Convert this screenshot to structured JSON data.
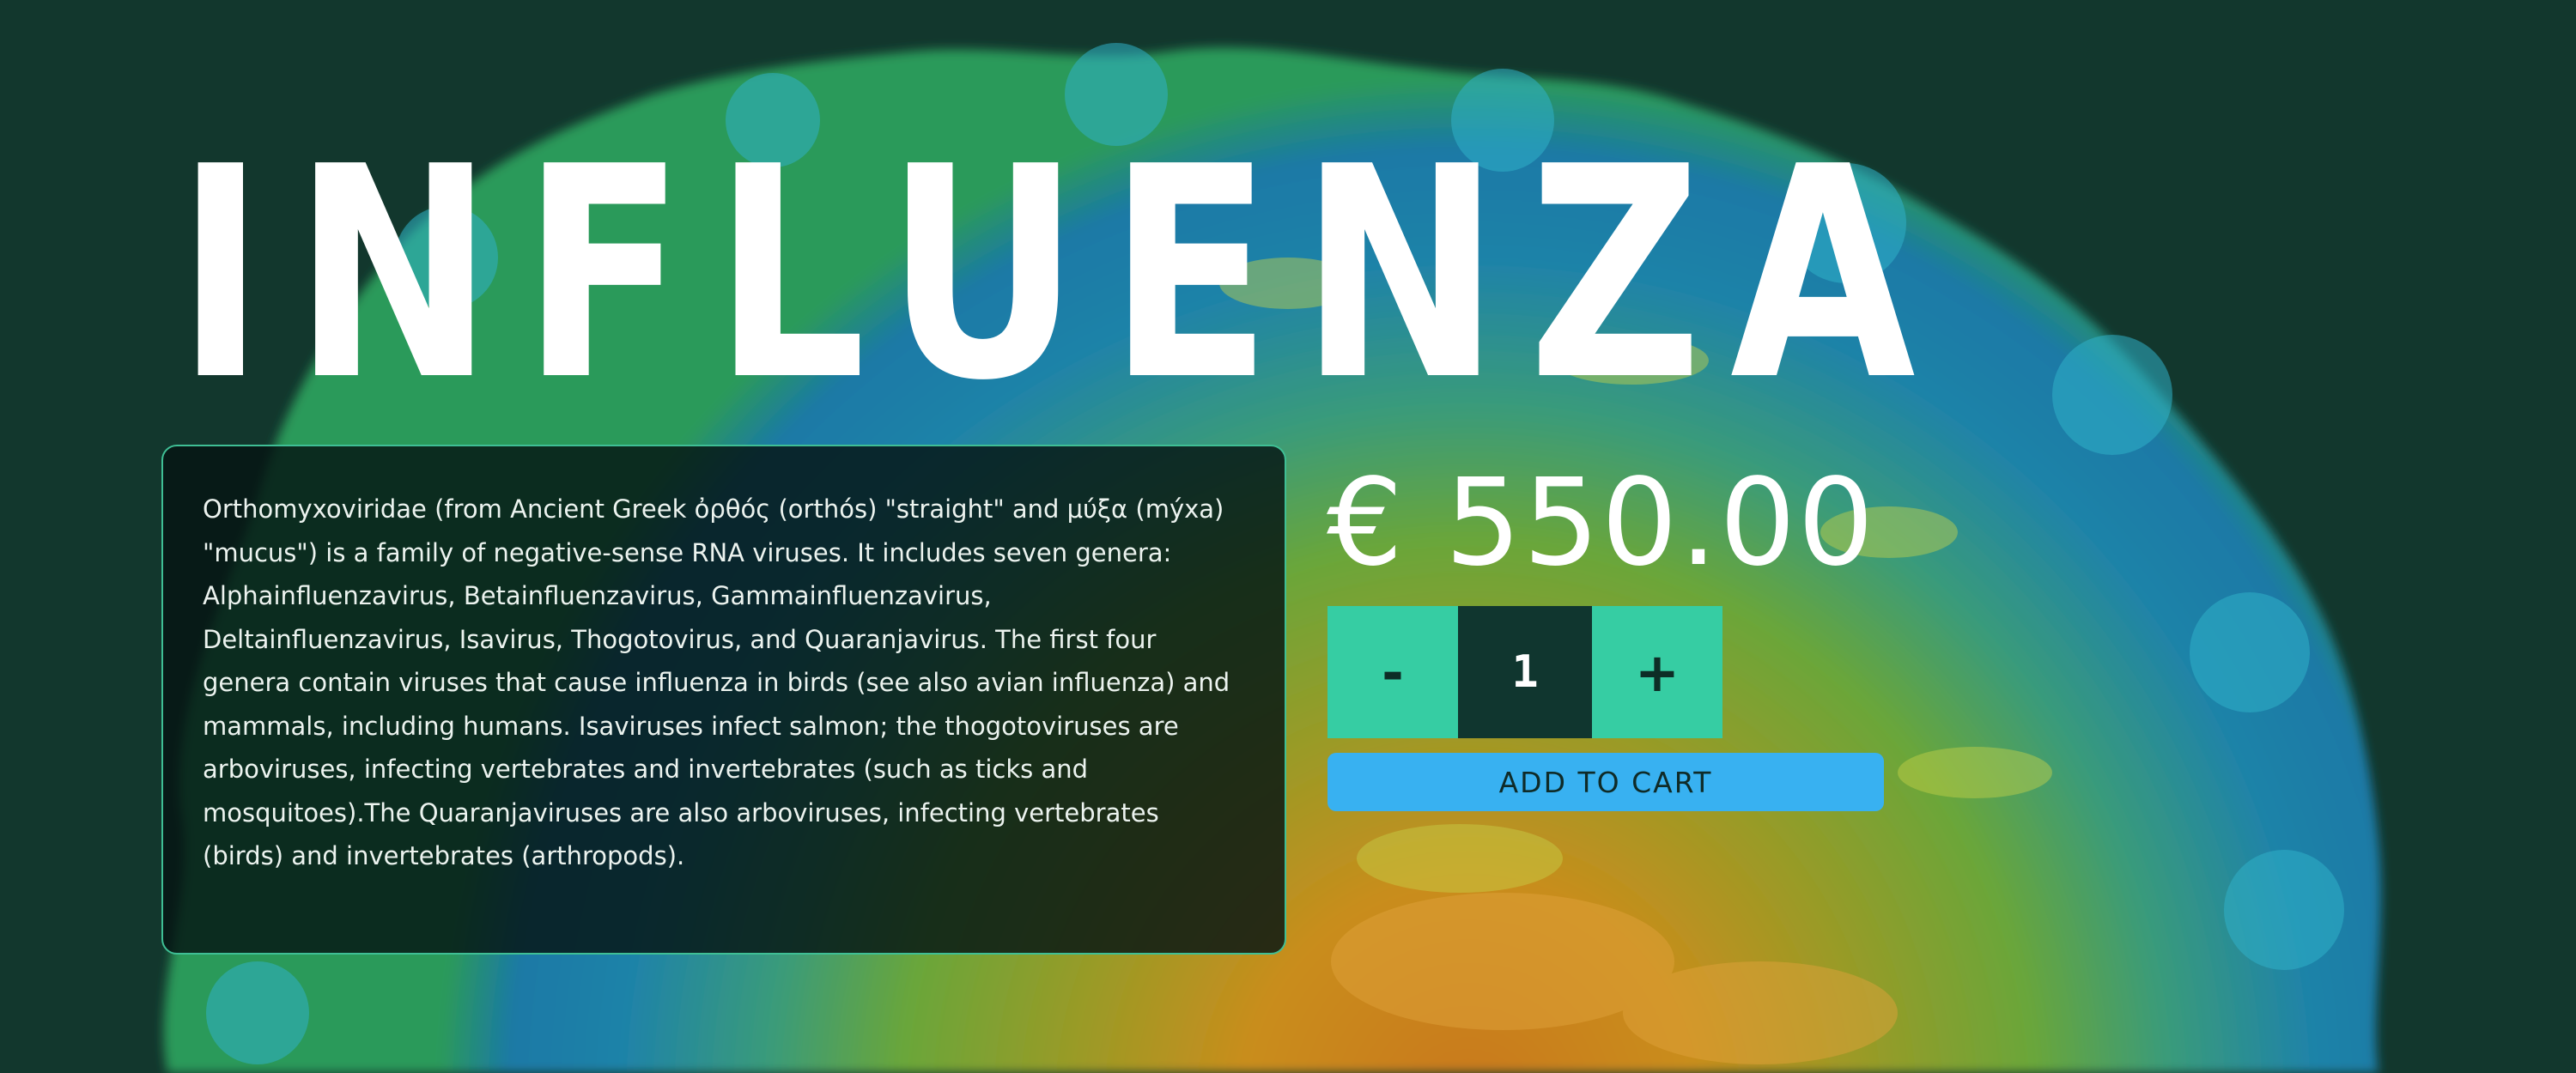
{
  "product": {
    "title": "INFLUENZA",
    "description": "Orthomyxoviridae (from Ancient Greek ὀρθός (orthós) \"straight\" and μύξα (mýxa) \"mucus\") is a family of negative-sense RNA viruses. It includes seven genera: Alphainfluenzavirus, Betainfluenzavirus, Gammainfluenzavirus, Deltainfluenzavirus, Isavirus, Thogotovirus, and Quaranjavirus. The first four genera contain viruses that cause influenza in birds (see also avian influenza) and mammals, including humans. Isaviruses infect salmon; the thogotoviruses are arboviruses, infecting vertebrates and invertebrates (such as ticks and mosquitoes).The Quaranjaviruses are also arboviruses, infecting vertebrates (birds) and invertebrates (arthropods).",
    "price": "€ 550.00"
  },
  "quantity": {
    "decrement_label": "-",
    "value": "1",
    "increment_label": "+"
  },
  "cart": {
    "add_label": "ADD TO CART"
  },
  "colors": {
    "background": "#12372d",
    "accent_green": "#36cda3",
    "accent_blue": "#38b1f1",
    "card_border": "#3fbf95"
  }
}
